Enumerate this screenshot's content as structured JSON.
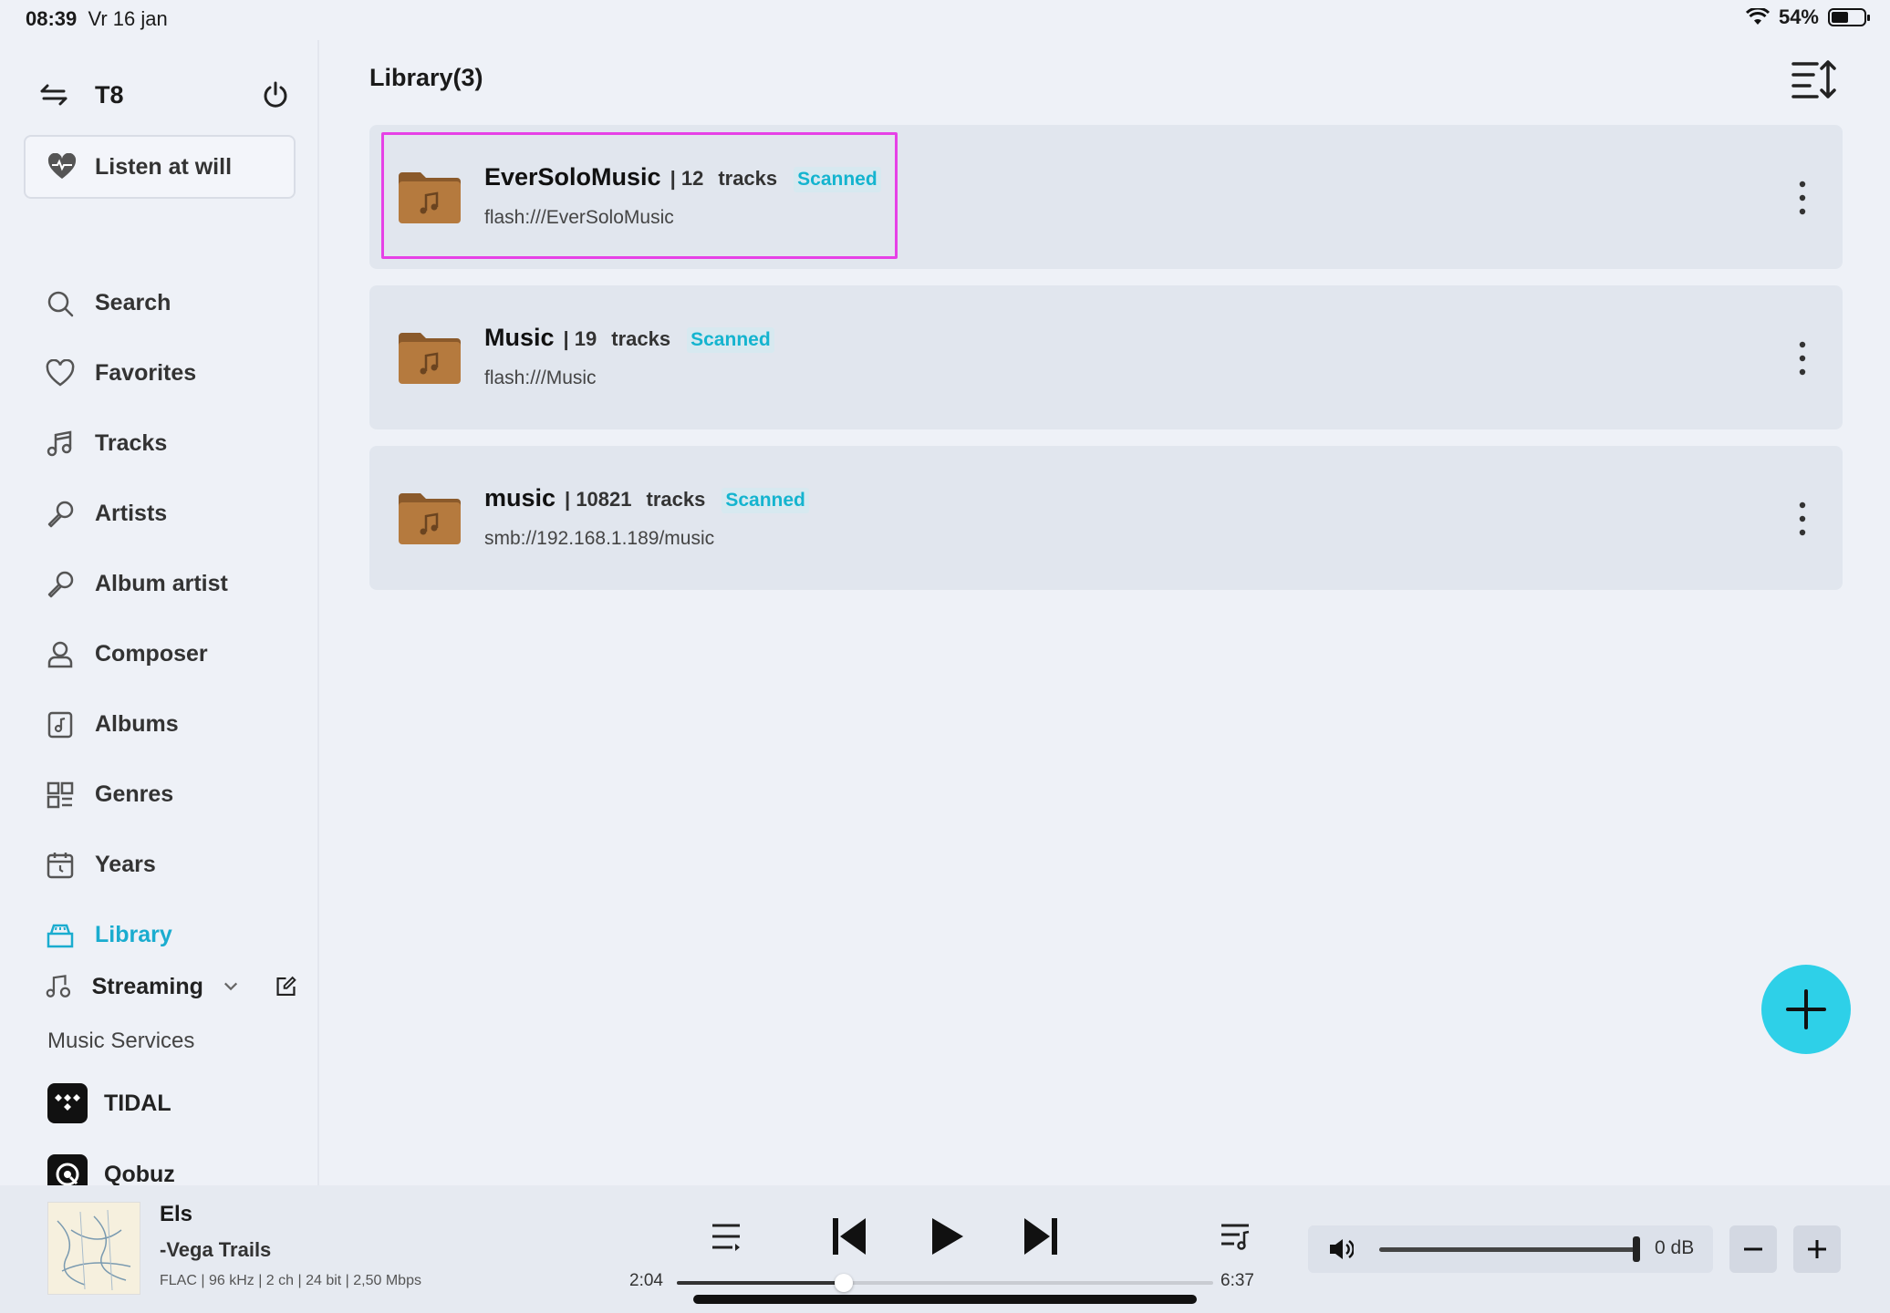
{
  "status": {
    "time": "08:39",
    "date": "Vr 16 jan",
    "battery": "54%",
    "battery_level": 0.54
  },
  "sidebar": {
    "device": "T8",
    "listen_label": "Listen at will",
    "items": [
      {
        "label": "Search",
        "icon": "search-icon"
      },
      {
        "label": "Favorites",
        "icon": "heart-icon"
      },
      {
        "label": "Tracks",
        "icon": "music-note-icon"
      },
      {
        "label": "Artists",
        "icon": "microphone-icon"
      },
      {
        "label": "Album artist",
        "icon": "microphone-icon"
      },
      {
        "label": "Composer",
        "icon": "person-icon"
      },
      {
        "label": "Albums",
        "icon": "album-icon"
      },
      {
        "label": "Genres",
        "icon": "grid-icon"
      },
      {
        "label": "Years",
        "icon": "calendar-icon"
      },
      {
        "label": "Library",
        "icon": "library-icon",
        "active": true
      }
    ],
    "streaming_label": "Streaming",
    "services_label": "Music Services",
    "services": [
      {
        "label": "TIDAL",
        "icon": "tidal-logo-icon"
      },
      {
        "label": "Qobuz",
        "icon": "qobuz-logo-icon"
      }
    ]
  },
  "main": {
    "title": "Library(3)",
    "libraries": [
      {
        "name": "EverSoloMusic",
        "count": "| 12",
        "tracks": "tracks",
        "status": "Scanned",
        "path": "flash:///EverSoloMusic"
      },
      {
        "name": "Music",
        "count": "| 19",
        "tracks": "tracks",
        "status": "Scanned",
        "path": "flash:///Music"
      },
      {
        "name": "music",
        "count": "| 10821",
        "tracks": "tracks",
        "status": "Scanned",
        "path": "smb://192.168.1.189/music"
      }
    ]
  },
  "player": {
    "title": "Els",
    "artist": "-Vega Trails",
    "format": "FLAC | 96 kHz | 2 ch | 24 bit | 2,50 Mbps",
    "elapsed": "2:04",
    "duration": "6:37",
    "progress": 0.312,
    "volume_db": "0 dB",
    "volume_level": 1.0
  },
  "colors": {
    "accent": "#1aaccf",
    "badge": "#14b4cf",
    "fab": "#2ed0e8",
    "card": "#e1e6ee",
    "highlight": "#e641e6"
  }
}
